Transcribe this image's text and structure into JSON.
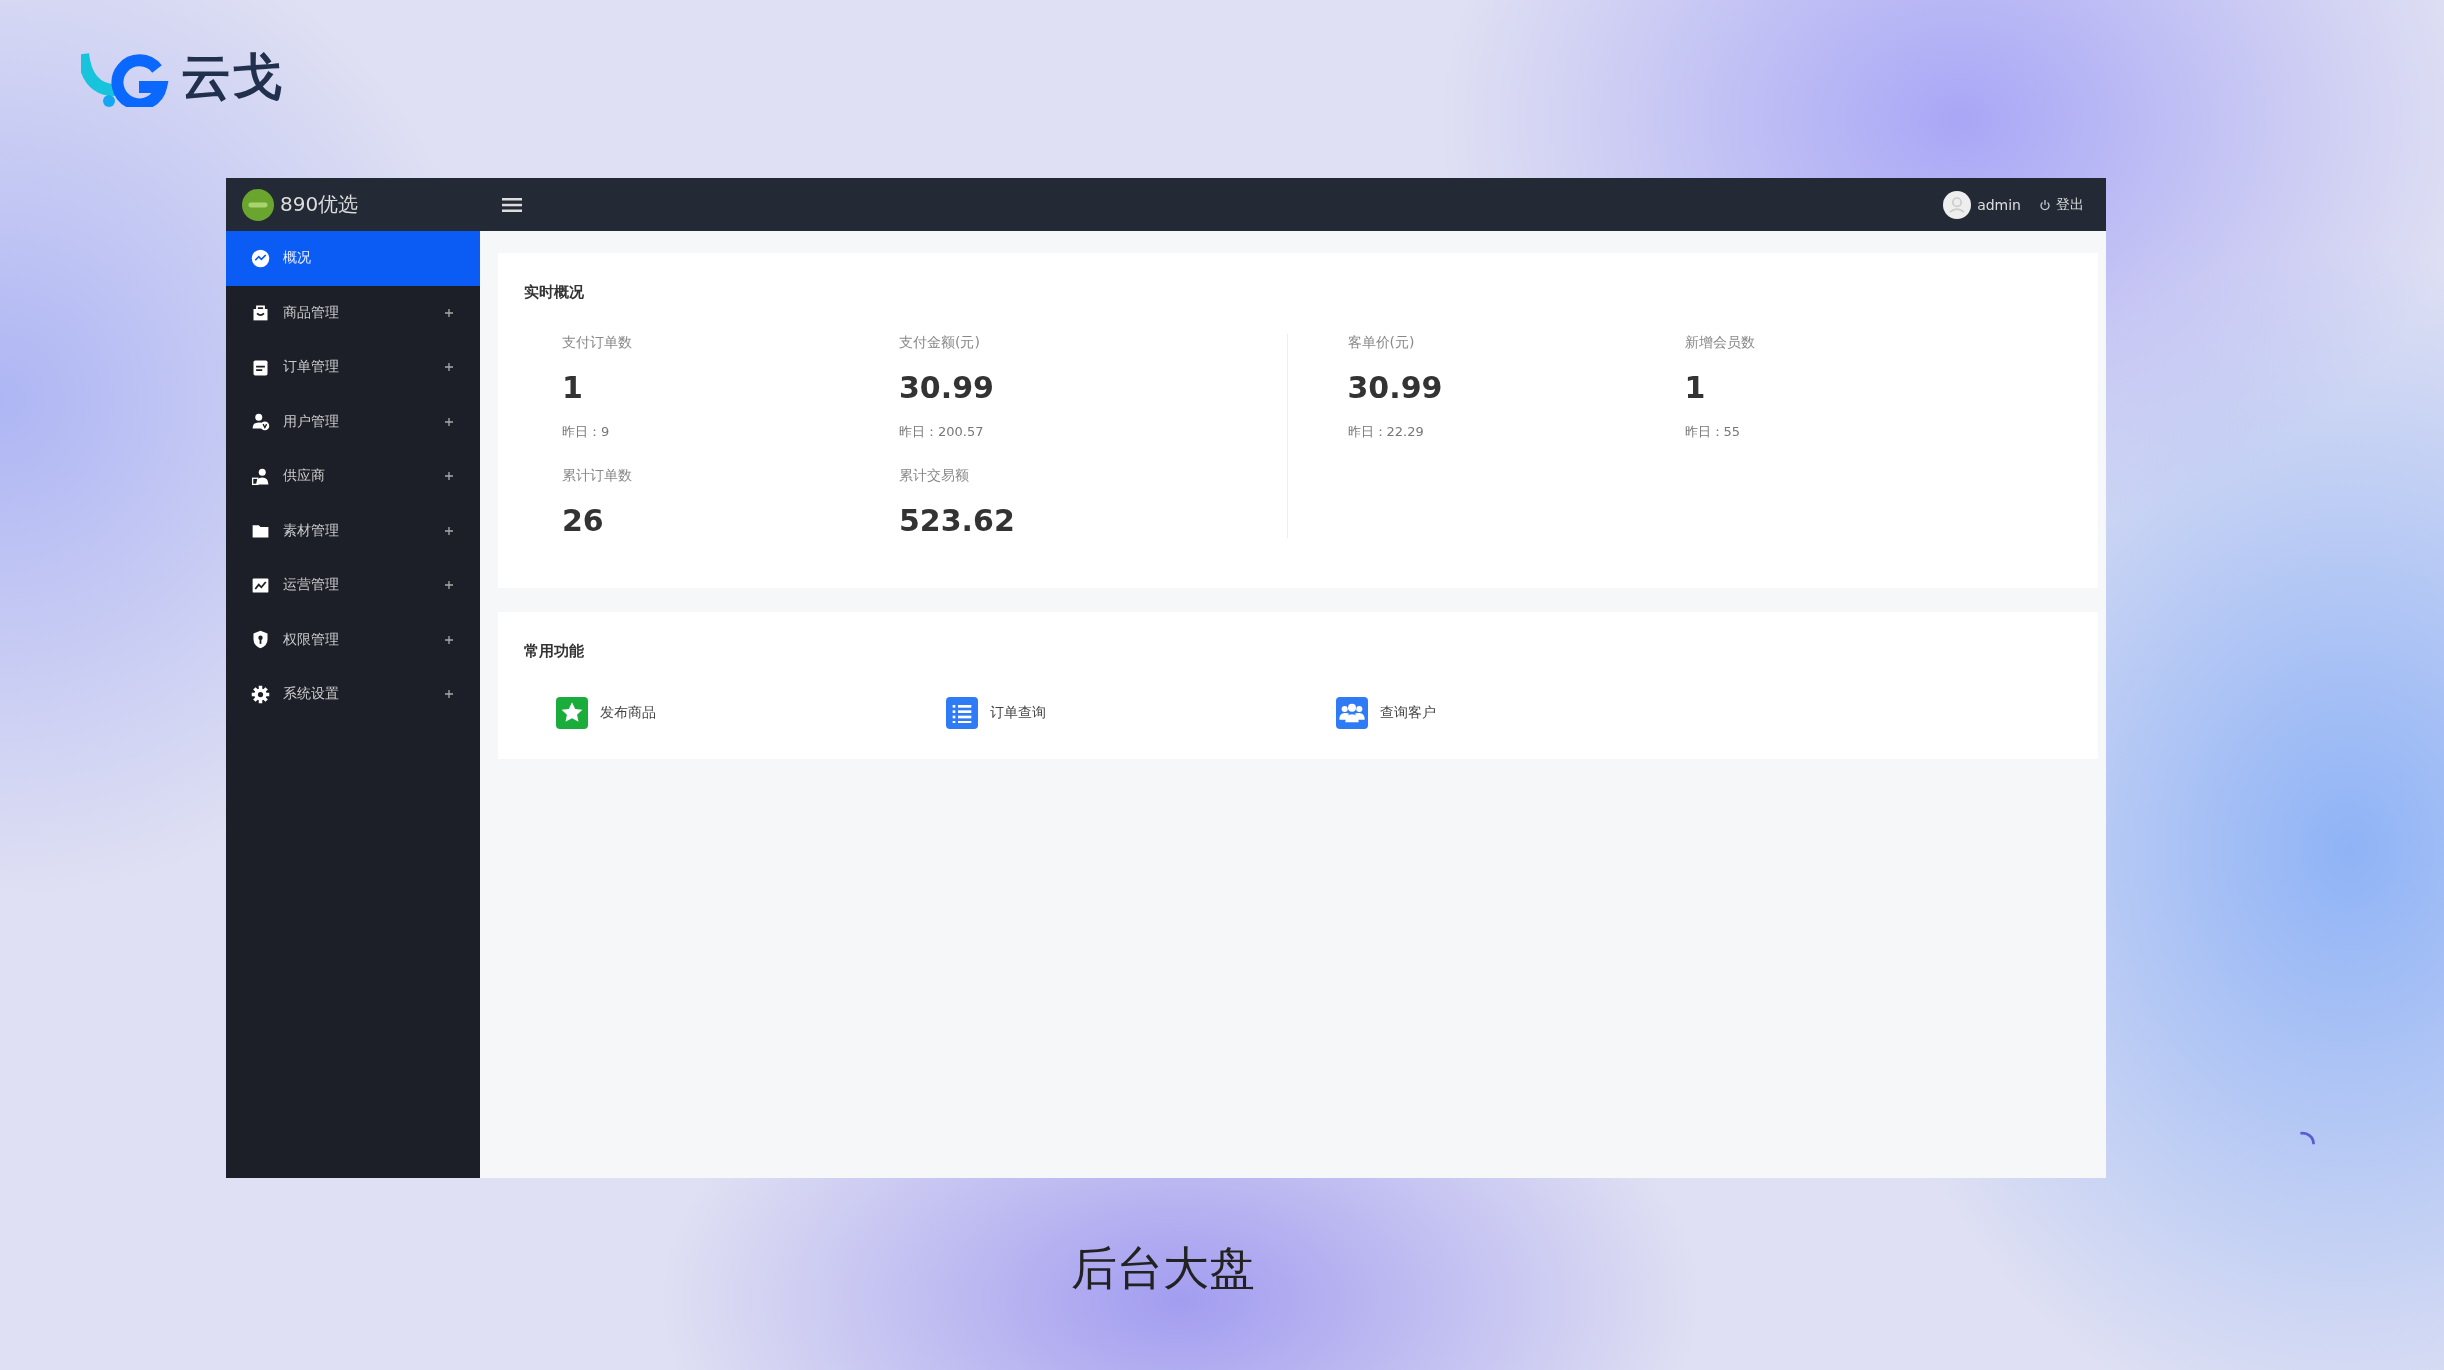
{
  "brand": {
    "name": "云戈"
  },
  "app": {
    "name": "890优选",
    "user": "admin",
    "logout": "登出"
  },
  "sidebar": {
    "items": [
      {
        "label": "概况",
        "selected": true,
        "expandable": false
      },
      {
        "label": "商品管理",
        "selected": false,
        "expandable": true
      },
      {
        "label": "订单管理",
        "selected": false,
        "expandable": true
      },
      {
        "label": "用户管理",
        "selected": false,
        "expandable": true
      },
      {
        "label": "供应商",
        "selected": false,
        "expandable": true
      },
      {
        "label": "素材管理",
        "selected": false,
        "expandable": true
      },
      {
        "label": "运营管理",
        "selected": false,
        "expandable": true
      },
      {
        "label": "权限管理",
        "selected": false,
        "expandable": true
      },
      {
        "label": "系统设置",
        "selected": false,
        "expandable": true
      }
    ]
  },
  "realtime": {
    "title": "实时概况",
    "groups": [
      {
        "stats": [
          {
            "label": "支付订单数",
            "value": "1",
            "yesterday": "昨日：9"
          },
          {
            "label": "支付金额(元)",
            "value": "30.99",
            "yesterday": "昨日：200.57"
          },
          {
            "label": "累计订单数",
            "value": "26"
          },
          {
            "label": "累计交易额",
            "value": "523.62"
          }
        ]
      },
      {
        "stats": [
          {
            "label": "客单价(元)",
            "value": "30.99",
            "yesterday": "昨日：22.29"
          },
          {
            "label": "新增会员数",
            "value": "1",
            "yesterday": "昨日：55"
          }
        ]
      }
    ]
  },
  "shortcuts": {
    "title": "常用功能",
    "items": [
      {
        "label": "发布商品"
      },
      {
        "label": "订单查询"
      },
      {
        "label": "查询客户"
      }
    ]
  },
  "caption": "后台大盘"
}
